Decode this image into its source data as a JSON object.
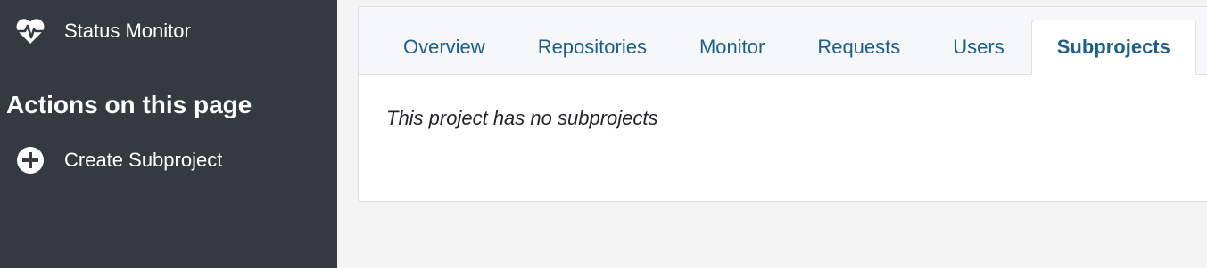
{
  "sidebar": {
    "status_monitor_label": "Status Monitor",
    "status_monitor_icon": "heartbeat-icon",
    "actions_heading": "Actions on this page",
    "create_subproject_label": "Create Subproject",
    "create_subproject_icon": "plus-circle-icon"
  },
  "tabs": [
    {
      "label": "Overview",
      "active": false
    },
    {
      "label": "Repositories",
      "active": false
    },
    {
      "label": "Monitor",
      "active": false
    },
    {
      "label": "Requests",
      "active": false
    },
    {
      "label": "Users",
      "active": false
    },
    {
      "label": "Subprojects",
      "active": true
    }
  ],
  "main": {
    "empty_message": "This project has no subprojects"
  },
  "colors": {
    "sidebar_bg": "#343a40",
    "tab_text": "#1d5f8a",
    "page_bg": "#f4f4f4"
  }
}
